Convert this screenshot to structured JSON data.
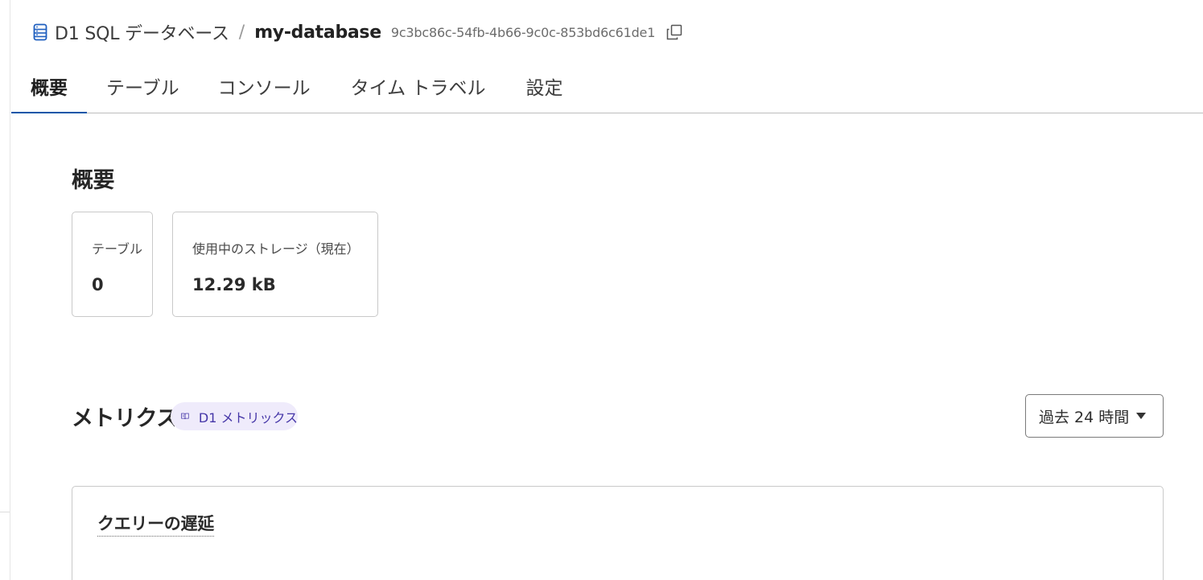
{
  "breadcrumb": {
    "product": "D1 SQL データベース",
    "separator": "/",
    "database_name": "my-database",
    "database_id": "9c3bc86c-54fb-4b66-9c0c-853bd6c61de1"
  },
  "tabs": [
    {
      "label": "概要",
      "active": true
    },
    {
      "label": "テーブル",
      "active": false
    },
    {
      "label": "コンソール",
      "active": false
    },
    {
      "label": "タイム トラベル",
      "active": false
    },
    {
      "label": "設定",
      "active": false
    }
  ],
  "overview": {
    "title": "概要",
    "cards": [
      {
        "label": "テーブル",
        "value": "0"
      },
      {
        "label": "使用中のストレージ（現在）",
        "value": "12.29 kB"
      }
    ]
  },
  "metrics": {
    "title": "メトリクス",
    "doc_badge_label": "D1 メトリックス",
    "time_range": "過去 24 時間",
    "chart_title": "クエリーの遅延"
  },
  "colors": {
    "active_tab_underline": "#0a56a8",
    "badge_bg": "#efebfb",
    "badge_text": "#4637a8",
    "icon_blue": "#1f5fbf"
  },
  "icons": {
    "database": "database-icon",
    "copy": "copy-icon",
    "book": "book-icon",
    "caret": "caret-down-icon"
  }
}
